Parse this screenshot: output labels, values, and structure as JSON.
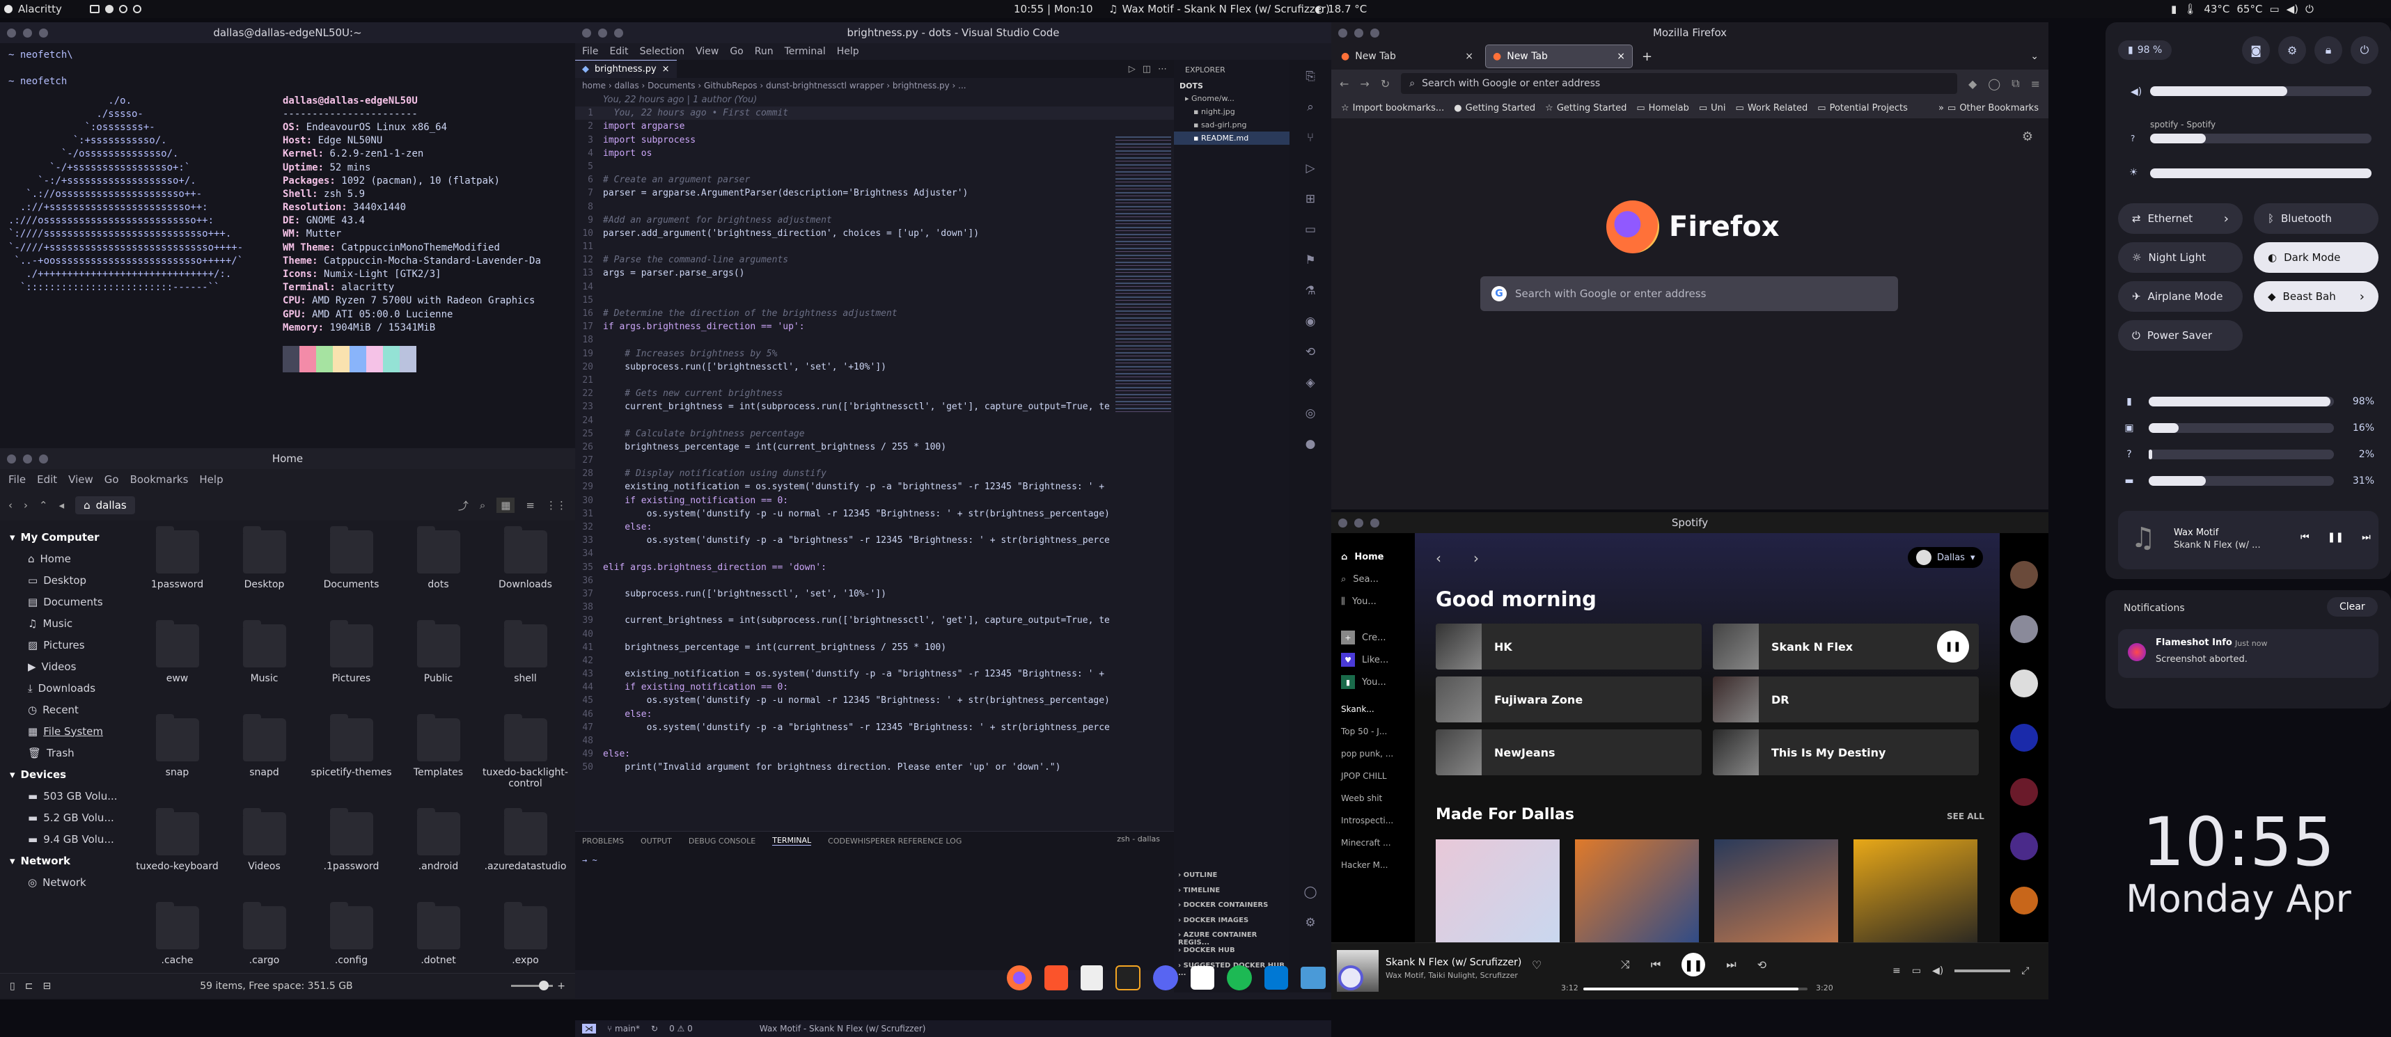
{
  "topbar": {
    "app_name": "Alacritty",
    "clock": "10:55 | Mon:10",
    "now_playing": "Wax Motif - Skank N Flex (w/ Scrufizzer)",
    "weather": "18.7 °C",
    "cpu_temps": "43°C",
    "gpu_temp": "65°C"
  },
  "terminal": {
    "title": "dallas@dallas-edgeNL50U:~",
    "lines": [
      "~ neofetch\\",
      "",
      "~ neofetch"
    ],
    "logo": [
      "                 ./o.",
      "               ./sssso-",
      "             `:osssssss+-",
      "           `:+sssssssssso/.",
      "         `-/ossssssssssssso/.",
      "       `-/+sssssssssssssssso+:`",
      "     `-:/+sssssssssssssssssso+/.",
      "   `.://osssssssssssssssssssso++-",
      "  .://+ssssssssssssssssssssssso++:",
      ".:///ossssssssssssssssssssssssso++:",
      "`:////ssssssssssssssssssssssssssso+++.",
      "`-////+ssssssssssssssssssssssssssso++++-",
      " `..-+oosssssssssssssssssssssssso+++++/`",
      "   ./++++++++++++++++++++++++++++++/:.",
      "  `:::::::::::::::::::::::::------``"
    ],
    "user_host": "dallas@dallas-edgeNL50U",
    "separator": "-----------------------",
    "info": [
      {
        "k": "OS",
        "v": "EndeavourOS Linux x86_64"
      },
      {
        "k": "Host",
        "v": "Edge NL50NU"
      },
      {
        "k": "Kernel",
        "v": "6.2.9-zen1-1-zen"
      },
      {
        "k": "Uptime",
        "v": "52 mins"
      },
      {
        "k": "Packages",
        "v": "1092 (pacman), 10 (flatpak)"
      },
      {
        "k": "Shell",
        "v": "zsh 5.9"
      },
      {
        "k": "Resolution",
        "v": "3440x1440"
      },
      {
        "k": "DE",
        "v": "GNOME 43.4"
      },
      {
        "k": "WM",
        "v": "Mutter"
      },
      {
        "k": "WM Theme",
        "v": "CatppuccinMonoThemeModified"
      },
      {
        "k": "Theme",
        "v": "Catppuccin-Mocha-Standard-Lavender-Da"
      },
      {
        "k": "Icons",
        "v": "Numix-Light [GTK2/3]"
      },
      {
        "k": "Terminal",
        "v": "alacritty"
      },
      {
        "k": "CPU",
        "v": "AMD Ryzen 7 5700U with Radeon Graphics"
      },
      {
        "k": "GPU",
        "v": "AMD ATI 05:00.0 Lucienne"
      },
      {
        "k": "Memory",
        "v": "1904MiB / 15341MiB"
      }
    ],
    "palette": [
      "#45475a",
      "#f38ba8",
      "#a6e3a1",
      "#f9e2af",
      "#89b4fa",
      "#f5c2e7",
      "#94e2d5",
      "#bac2de"
    ],
    "prompt": "~ "
  },
  "files": {
    "title": "Home",
    "menu": [
      "File",
      "Edit",
      "View",
      "Go",
      "Bookmarks",
      "Help"
    ],
    "path": "dallas",
    "sidebar": {
      "my_computer": "My Computer",
      "places": [
        "Home",
        "Desktop",
        "Documents",
        "Music",
        "Pictures",
        "Videos",
        "Downloads",
        "Recent",
        "File System",
        "Trash"
      ],
      "devices_head": "Devices",
      "devices": [
        "503 GB Volu...",
        "5.2 GB Volu...",
        "9.4 GB Volu..."
      ],
      "network_head": "Network",
      "network": [
        "Network"
      ]
    },
    "items": [
      "1password",
      "Desktop",
      "Documents",
      "dots",
      "Downloads",
      "eww",
      "Music",
      "Pictures",
      "Public",
      "shell",
      "snap",
      "snapd",
      "spicetify-themes",
      "Templates",
      "tuxedo-backlight-control",
      "tuxedo-keyboard",
      "Videos",
      ".1password",
      ".android",
      ".azuredatastudio",
      ".cache",
      ".cargo",
      ".config",
      ".dotnet",
      ".expo"
    ],
    "status": "59 items, Free space: 351.5 GB"
  },
  "vscode": {
    "title": "brightness.py - dots - Visual Studio Code",
    "menu": [
      "File",
      "Edit",
      "Selection",
      "View",
      "Go",
      "Run",
      "Terminal",
      "Help"
    ],
    "tab": "brightness.py",
    "breadcrumb": [
      "home",
      "dallas",
      "Documents",
      "GithubRepos",
      "dunst-brightnessctl wrapper",
      "brightness.py",
      "..."
    ],
    "blame": "You, 22 hours ago | 1 author (You)",
    "explorer": "EXPLORER",
    "dots": "DOTS",
    "tree": [
      "Gnome/w...",
      "night.jpg",
      "sad-girl.png",
      "README.md"
    ],
    "outline_sections": [
      "OUTLINE",
      "TIMELINE",
      "DOCKER CONTAINERS",
      "DOCKER IMAGES",
      "AZURE CONTAINER REGIS...",
      "DOCKER HUB",
      "SUGGESTED DOCKER HUB ..."
    ],
    "panel_tabs": [
      "PROBLEMS",
      "OUTPUT",
      "DEBUG CONSOLE",
      "TERMINAL",
      "CODEWHISPERER REFERENCE LOG"
    ],
    "panel_shell": "zsh - dallas",
    "panel_prompt": "→ ~",
    "status_branch": "main*",
    "status_errors": "0 ⚠ 0",
    "status_song": "Wax Motif - Skank N Flex (w/ Scrufizzer)",
    "code": [
      {
        "n": "1",
        "t": "  You, 22 hours ago • First commit",
        "c": "cm"
      },
      {
        "n": "2",
        "t": "import argparse",
        "c": "imp"
      },
      {
        "n": "3",
        "t": "import subprocess",
        "c": "imp"
      },
      {
        "n": "4",
        "t": "import os",
        "c": "imp"
      },
      {
        "n": "5",
        "t": "",
        "c": ""
      },
      {
        "n": "6",
        "t": "# Create an argument parser",
        "c": "cm"
      },
      {
        "n": "7",
        "t": "parser = argparse.ArgumentParser(description='Brightness Adjuster')",
        "c": "vr"
      },
      {
        "n": "8",
        "t": "",
        "c": ""
      },
      {
        "n": "9",
        "t": "#Add an argument for brightness adjustment",
        "c": "cm"
      },
      {
        "n": "10",
        "t": "parser.add_argument('brightness_direction', choices = ['up', 'down'])",
        "c": "vr"
      },
      {
        "n": "11",
        "t": "",
        "c": ""
      },
      {
        "n": "12",
        "t": "# Parse the command-line arguments",
        "c": "cm"
      },
      {
        "n": "13",
        "t": "args = parser.parse_args()",
        "c": "vr"
      },
      {
        "n": "14",
        "t": "",
        "c": ""
      },
      {
        "n": "15",
        "t": "",
        "c": ""
      },
      {
        "n": "16",
        "t": "# Determine the direction of the brightness adjustment",
        "c": "cm"
      },
      {
        "n": "17",
        "t": "if args.brightness_direction == 'up':",
        "c": "kw"
      },
      {
        "n": "18",
        "t": "",
        "c": ""
      },
      {
        "n": "19",
        "t": "    # Increases brightness by 5%",
        "c": "cm"
      },
      {
        "n": "20",
        "t": "    subprocess.run(['brightnessctl', 'set', '+10%'])",
        "c": "vr"
      },
      {
        "n": "21",
        "t": "",
        "c": ""
      },
      {
        "n": "22",
        "t": "    # Gets new current brightness",
        "c": "cm"
      },
      {
        "n": "23",
        "t": "    current_brightness = int(subprocess.run(['brightnessctl', 'get'], capture_output=True, te",
        "c": "vr"
      },
      {
        "n": "24",
        "t": "",
        "c": ""
      },
      {
        "n": "25",
        "t": "    # Calculate brightness percentage",
        "c": "cm"
      },
      {
        "n": "26",
        "t": "    brightness_percentage = int(current_brightness / 255 * 100)",
        "c": "vr"
      },
      {
        "n": "27",
        "t": "",
        "c": ""
      },
      {
        "n": "28",
        "t": "    # Display notification using dunstify",
        "c": "cm"
      },
      {
        "n": "29",
        "t": "    existing_notification = os.system('dunstify -p -a \"brightness\" -r 12345 \"Brightness: ' +",
        "c": "vr"
      },
      {
        "n": "30",
        "t": "    if existing_notification == 0:",
        "c": "kw"
      },
      {
        "n": "31",
        "t": "        os.system('dunstify -p -u normal -r 12345 \"Brightness: ' + str(brightness_percentage)",
        "c": "vr"
      },
      {
        "n": "32",
        "t": "    else:",
        "c": "kw"
      },
      {
        "n": "33",
        "t": "        os.system('dunstify -p -a \"brightness\" -r 12345 \"Brightness: ' + str(brightness_perce",
        "c": "vr"
      },
      {
        "n": "34",
        "t": "",
        "c": ""
      },
      {
        "n": "35",
        "t": "elif args.brightness_direction == 'down':",
        "c": "kw"
      },
      {
        "n": "36",
        "t": "",
        "c": ""
      },
      {
        "n": "37",
        "t": "    subprocess.run(['brightnessctl', 'set', '10%-'])",
        "c": "vr"
      },
      {
        "n": "38",
        "t": "",
        "c": ""
      },
      {
        "n": "39",
        "t": "    current_brightness = int(subprocess.run(['brightnessctl', 'get'], capture_output=True, te",
        "c": "vr"
      },
      {
        "n": "40",
        "t": "",
        "c": ""
      },
      {
        "n": "41",
        "t": "    brightness_percentage = int(current_brightness / 255 * 100)",
        "c": "vr"
      },
      {
        "n": "42",
        "t": "",
        "c": ""
      },
      {
        "n": "43",
        "t": "    existing_notification = os.system('dunstify -p -a \"brightness\" -r 12345 \"Brightness: ' +",
        "c": "vr"
      },
      {
        "n": "44",
        "t": "    if existing_notification == 0:",
        "c": "kw"
      },
      {
        "n": "45",
        "t": "        os.system('dunstify -p -u normal -r 12345 \"Brightness: ' + str(brightness_percentage)",
        "c": "vr"
      },
      {
        "n": "46",
        "t": "    else:",
        "c": "kw"
      },
      {
        "n": "47",
        "t": "        os.system('dunstify -p -a \"brightness\" -r 12345 \"Brightness: ' + str(brightness_perce",
        "c": "vr"
      },
      {
        "n": "48",
        "t": "",
        "c": ""
      },
      {
        "n": "49",
        "t": "else:",
        "c": "kw"
      },
      {
        "n": "50",
        "t": "    print(\"Invalid argument for brightness direction. Please enter 'up' or 'down'.\")",
        "c": "vr"
      }
    ]
  },
  "firefox": {
    "title": "Mozilla Firefox",
    "tabs": [
      "New Tab",
      "New Tab"
    ],
    "urlbar_placeholder": "Search with Google or enter address",
    "bookmarks": [
      "Import bookmarks...",
      "Getting Started",
      "Getting Started",
      "Homelab",
      "Uni",
      "Work Related",
      "Potential Projects"
    ],
    "other_bookmarks": "Other Bookmarks",
    "brand": "Firefox",
    "search_placeholder": "Search with Google or enter address"
  },
  "spotify": {
    "title": "Spotify",
    "nav": [
      "Home",
      "Sea...",
      "You..."
    ],
    "library": [
      "Cre...",
      "Like...",
      "You..."
    ],
    "playlists": [
      "Skank...",
      "Top 50 - J...",
      "pop punk, ...",
      "JPOP CHILL",
      "Weeb shit",
      "Introspecti...",
      "Minecraft ...",
      "Hacker M..."
    ],
    "user": "Dallas",
    "greeting": "Good morning",
    "cards": [
      "HK",
      "Skank N Flex",
      "Fujiwara Zone",
      "DR",
      "NewJeans",
      "This Is My Destiny"
    ],
    "section": "Made For Dallas",
    "see_all": "SEE ALL",
    "track": "Skank N Flex (w/ Scrufizzer)",
    "artists": "Wax Motif, Taiki Nulight, Scrufizzer",
    "elapsed": "3:12",
    "duration": "3:20",
    "progress": 0.96
  },
  "quick_settings": {
    "battery": "98 %",
    "volume_level": 0.62,
    "media_app": "spotify - Spotify",
    "media_level": 0.25,
    "brightness_level": 1.0,
    "toggles": [
      {
        "label": "Ethernet",
        "on": false,
        "arrow": true
      },
      {
        "label": "Bluetooth",
        "on": false,
        "arrow": false
      },
      {
        "label": "Night Light",
        "on": false,
        "arrow": false
      },
      {
        "label": "Dark Mode",
        "on": true,
        "arrow": false
      },
      {
        "label": "Airplane Mode",
        "on": false,
        "arrow": false
      },
      {
        "label": "Beast Bah",
        "on": true,
        "arrow": true
      },
      {
        "label": "Power Saver",
        "on": false,
        "arrow": false
      }
    ],
    "meters": [
      {
        "label": "98%",
        "value": 0.98
      },
      {
        "label": "16%",
        "value": 0.16
      },
      {
        "label": "2%",
        "value": 0.02
      },
      {
        "label": "31%",
        "value": 0.31
      }
    ],
    "player_title": "Wax Motif",
    "player_sub": "Skank N Flex (w/ ...",
    "notifications": "Notifications",
    "clear": "Clear",
    "notif_app": "Flameshot Info",
    "notif_time": "Just now",
    "notif_body": "Screenshot aborted."
  },
  "desktop_clock": {
    "time": "10:55",
    "date": "Monday Apr"
  },
  "colors": {
    "accent": "#b4befe",
    "spotify_green": "#1db954",
    "firefox_orange": "#ff7139"
  }
}
